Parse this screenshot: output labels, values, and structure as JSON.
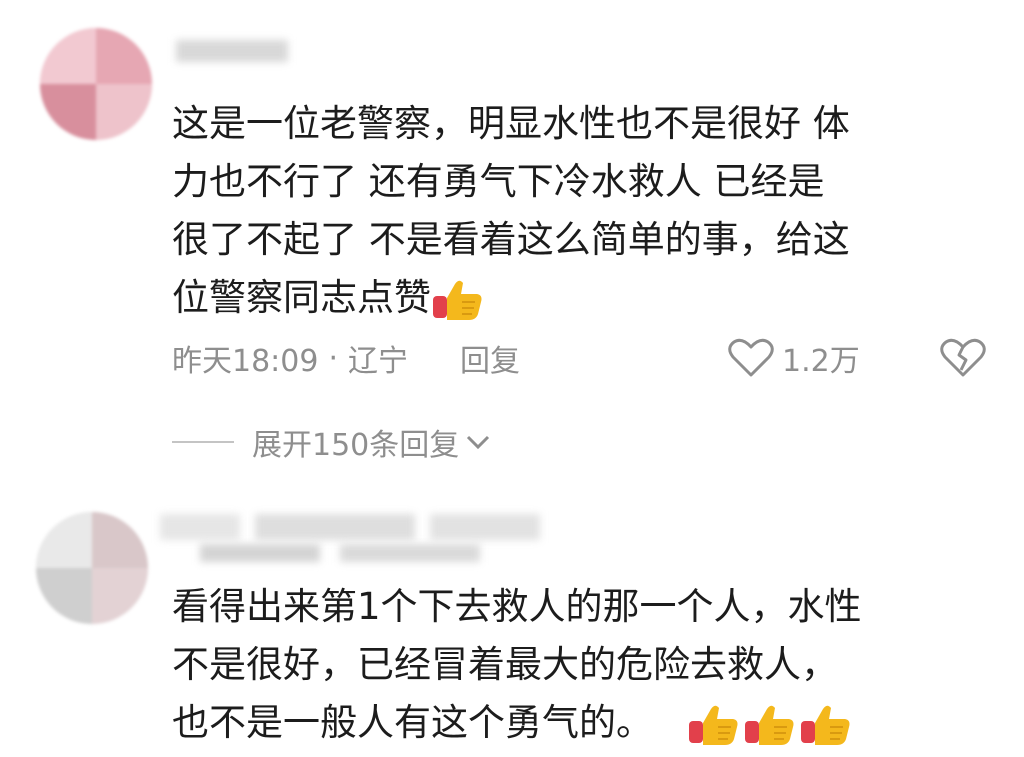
{
  "comments": [
    {
      "username": "",
      "text_lines": [
        "这是一位老警察，明显水性也不是很好  体",
        "力也不行了  还有勇气下冷水救人  已经是",
        "很了不起了   不是看着这么简单的事，给这",
        "位警察同志点赞"
      ],
      "emoji_count": 1,
      "time": "昨天18:09",
      "separator": "·",
      "location": "辽宁",
      "reply_label": "回复",
      "like_count": "1.2万",
      "expand_label": "展开150条回复"
    },
    {
      "username": "",
      "text_lines": [
        "看得出来第1个下去救人的那一个人，水性",
        "不是很好，已经冒着最大的危险去救人，",
        "也不是一般人有这个勇气的。"
      ],
      "emoji_count": 3
    }
  ],
  "icons": {
    "like": "heart-outline-icon",
    "dislike": "broken-heart-icon",
    "expand": "chevron-down-icon",
    "emoji": "thumbs-up-emoji"
  },
  "colors": {
    "text": "#1c1c1c",
    "meta": "#8e8e8e",
    "avatar1": "#e8b9c2",
    "emoji_yellow": "#f4b81c",
    "emoji_red": "#e2404b"
  }
}
